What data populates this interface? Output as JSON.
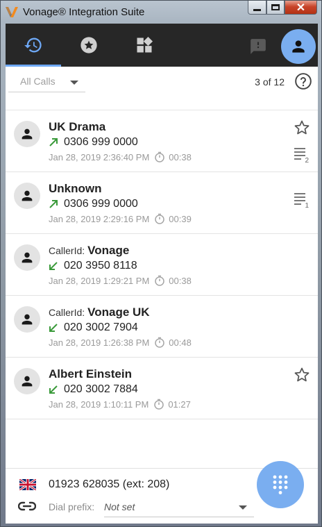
{
  "window": {
    "title": "Vonage® Integration Suite",
    "controls": {
      "minimize": "minimize",
      "maximize": "maximize",
      "close": "✕"
    }
  },
  "nav": {
    "tabs": [
      {
        "id": "history",
        "icon": "history-icon",
        "active": true
      },
      {
        "id": "favorites",
        "icon": "star-circle-icon",
        "active": false
      },
      {
        "id": "apps",
        "icon": "widgets-icon",
        "active": false
      }
    ],
    "chat_icon": "chat-icon",
    "avatar_icon": "person-icon",
    "accent_color": "#6ea8f5"
  },
  "filter": {
    "selected": "All Calls",
    "page_count": "3 of 12",
    "help_icon": "help-icon"
  },
  "calls": [
    {
      "prefix": "",
      "name": "UK Drama",
      "direction": "outgoing",
      "number": "0306 999 0000",
      "datetime": "Jan 28, 2019 2:36:40 PM",
      "duration": "00:38",
      "starred": true,
      "notes": "2"
    },
    {
      "prefix": "",
      "name": "Unknown",
      "direction": "outgoing",
      "number": "0306 999 0000",
      "datetime": "Jan 28, 2019 2:29:16 PM",
      "duration": "00:39",
      "starred": false,
      "notes": "1"
    },
    {
      "prefix": "CallerId:",
      "name": "Vonage",
      "direction": "incoming",
      "number": "020 3950 8118",
      "datetime": "Jan 28, 2019 1:29:21 PM",
      "duration": "00:38",
      "starred": false,
      "notes": ""
    },
    {
      "prefix": "CallerId:",
      "name": "Vonage UK",
      "direction": "incoming",
      "number": "020 3002 7904",
      "datetime": "Jan 28, 2019 1:26:38 PM",
      "duration": "00:48",
      "starred": false,
      "notes": ""
    },
    {
      "prefix": "",
      "name": "Albert Einstein",
      "direction": "incoming",
      "number": "020 3002 7884",
      "datetime": "Jan 28, 2019 1:10:11 PM",
      "duration": "01:27",
      "starred": true,
      "notes": ""
    }
  ],
  "footer": {
    "flag_icon": "uk-flag-icon",
    "phone": "01923 628035 (ext: 208)",
    "dial_prefix_label": "Dial prefix:",
    "dial_prefix_value": "Not set",
    "dialpad_icon": "dialpad-icon",
    "fab_color": "#7aaef0"
  }
}
